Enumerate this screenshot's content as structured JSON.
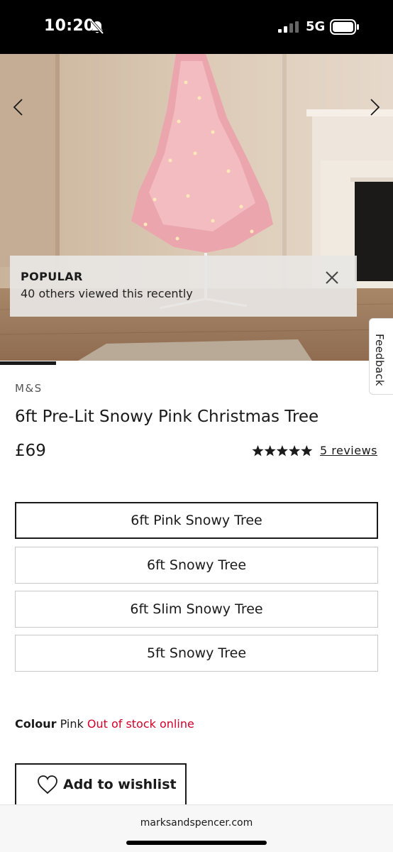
{
  "status_bar": {
    "time": "10:20",
    "network": "5G",
    "icons": [
      "bell-off-icon",
      "signal-icon",
      "battery-icon"
    ]
  },
  "gallery": {
    "popular_title": "POPULAR",
    "popular_subtitle": "40 others viewed this recently"
  },
  "feedback": {
    "label": "Feedback"
  },
  "product": {
    "brand": "M&S",
    "title": "6ft Pre-Lit Snowy Pink Christmas Tree",
    "price": "£69",
    "rating": 5,
    "rating_max": 5,
    "reviews_label": "5 reviews"
  },
  "variants": [
    {
      "label": "6ft Pink Snowy Tree",
      "selected": true
    },
    {
      "label": "6ft Snowy Tree",
      "selected": false
    },
    {
      "label": "6ft Slim Snowy Tree",
      "selected": false
    },
    {
      "label": "5ft Snowy Tree",
      "selected": false
    }
  ],
  "colour": {
    "label": "Colour",
    "value": "Pink",
    "stock_status": "Out of stock online"
  },
  "wishlist": {
    "label": "Add to wishlist"
  },
  "browser": {
    "url": "marksandspencer.com"
  },
  "colors": {
    "accent_red": "#d3002a",
    "text_dark": "#1a1a1a"
  }
}
